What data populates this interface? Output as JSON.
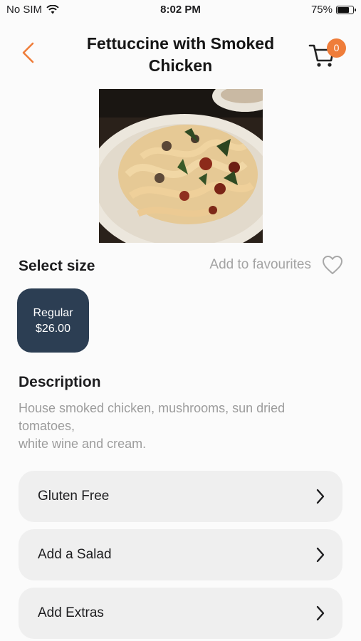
{
  "status_bar": {
    "carrier": "No SIM",
    "time": "8:02 PM",
    "battery_percent": "75%",
    "battery_level": 0.75
  },
  "header": {
    "title": "Fettuccine with Smoked Chicken",
    "cart_count": "0",
    "accent_color": "#ef7d3a"
  },
  "size": {
    "label": "Select size",
    "favourites_label": "Add to favourites",
    "options": [
      {
        "name": "Regular",
        "price": "$26.00"
      }
    ]
  },
  "description": {
    "title": "Description",
    "text": "House smoked chicken, mushrooms, sun dried tomatoes,\nwhite wine and cream."
  },
  "options": [
    {
      "label": "Gluten Free"
    },
    {
      "label": "Add a Salad"
    },
    {
      "label": "Add Extras"
    }
  ],
  "icons": {
    "back": "chevron-left-icon",
    "cart": "cart-icon",
    "favourite": "heart-icon",
    "row": "chevron-right-icon"
  }
}
